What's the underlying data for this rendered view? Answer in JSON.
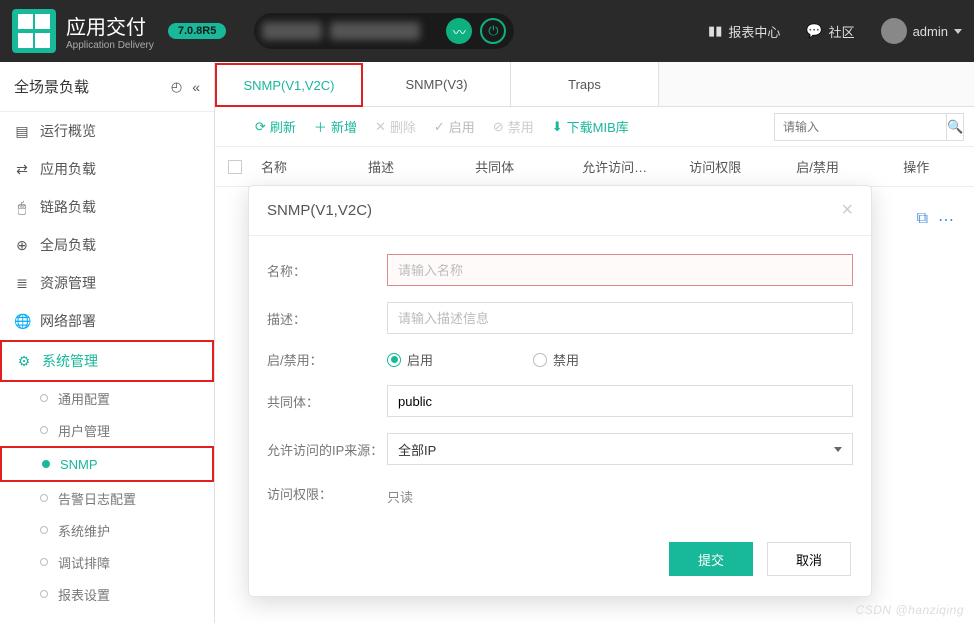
{
  "header": {
    "app_cn": "应用交付",
    "app_en": "Application Delivery",
    "version": "7.0.8R5",
    "links": {
      "report": "报表中心",
      "community": "社区",
      "user": "admin"
    }
  },
  "sidebar": {
    "title": "全场景负载",
    "items": [
      {
        "icon": "dashboard-icon",
        "label": "运行概览"
      },
      {
        "icon": "shuffle-icon",
        "label": "应用负载"
      },
      {
        "icon": "mouse-icon",
        "label": "链路负载"
      },
      {
        "icon": "globe-icon",
        "label": "全局负载"
      },
      {
        "icon": "stack-icon",
        "label": "资源管理"
      },
      {
        "icon": "world-icon",
        "label": "网络部署"
      },
      {
        "icon": "gear-icon",
        "label": "系统管理",
        "active": true
      }
    ],
    "sub": [
      {
        "label": "通用配置"
      },
      {
        "label": "用户管理"
      },
      {
        "label": "SNMP",
        "current": true
      },
      {
        "label": "告警日志配置"
      },
      {
        "label": "系统维护"
      },
      {
        "label": "调试排障"
      },
      {
        "label": "报表设置"
      }
    ]
  },
  "tabs": {
    "t1": "SNMP(V1,V2C)",
    "t2": "SNMP(V3)",
    "t3": "Traps"
  },
  "toolbar": {
    "refresh": "刷新",
    "add": "新增",
    "delete": "删除",
    "enable": "启用",
    "disable": "禁用",
    "download": "下载MIB库",
    "search_placeholder": "请输入"
  },
  "columns": {
    "c1": "名称",
    "c2": "描述",
    "c3": "共同体",
    "c4": "允许访问…",
    "c5": "访问权限",
    "c6": "启/禁用",
    "c7": "操作"
  },
  "modal": {
    "title": "SNMP(V1,V2C)",
    "labels": {
      "name": "名称：",
      "desc": "描述：",
      "enable": "启/禁用：",
      "community": "共同体：",
      "ip_source": "允许访问的IP来源：",
      "permission": "访问权限："
    },
    "placeholders": {
      "name": "请输入名称",
      "desc": "请输入描述信息"
    },
    "radio_enable": "启用",
    "radio_disable": "禁用",
    "community_value": "public",
    "ip_source_value": "全部IP",
    "permission_value": "只读",
    "submit": "提交",
    "cancel": "取消"
  },
  "watermark": "CSDN @hanziqing"
}
